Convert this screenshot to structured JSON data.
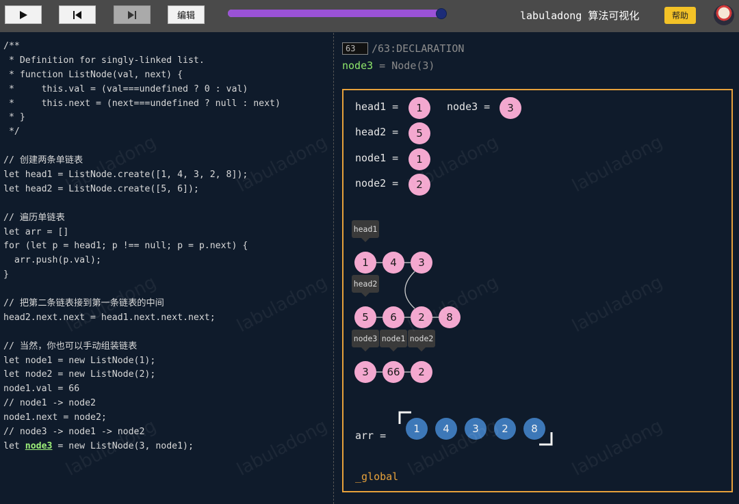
{
  "toolbar": {
    "play_icon": "play-icon",
    "prev_icon": "step-back-icon",
    "next_icon": "step-forward-icon",
    "edit_label": "编辑",
    "progress": 1.0,
    "brand": "labuladong 算法可视化",
    "help_label": "帮助"
  },
  "code": {
    "lines": [
      "/**",
      " * Definition for singly-linked list.",
      " * function ListNode(val, next) {",
      " *     this.val = (val===undefined ? 0 : val)",
      " *     this.next = (next===undefined ? null : next)",
      " * }",
      " */",
      "",
      "// 创建两条单链表",
      "let head1 = ListNode.create([1, 4, 3, 2, 8]);",
      "let head2 = ListNode.create([5, 6]);",
      "",
      "// 遍历单链表",
      "let arr = []",
      "for (let p = head1; p !== null; p = p.next) {",
      "  arr.push(p.val);",
      "}",
      "",
      "// 把第二条链表接到第一条链表的中间",
      "head2.next.next = head1.next.next.next;",
      "",
      "// 当然，你也可以手动组装链表",
      "let node1 = new ListNode(1);",
      "let node2 = new ListNode(2);",
      "node1.val = 66",
      "// node1 -> node2",
      "node1.next = node2;",
      "// node3 -> node1 -> node2"
    ],
    "last_prefix": "let ",
    "last_highlight": "node3",
    "last_suffix": " = new ListNode(3, node1);"
  },
  "step": {
    "input": "63",
    "total": "/63:DECLARATION",
    "decl_var": "node3",
    "decl_rest": " = Node(3)"
  },
  "viz": {
    "vars": [
      {
        "label": "head1 =",
        "value": "1"
      },
      {
        "label": "node3 =",
        "value": "3"
      },
      {
        "label": "head2 =",
        "value": "5"
      },
      {
        "label": "node1 =",
        "value": "1"
      },
      {
        "label": "node2 =",
        "value": "2"
      }
    ],
    "tags": [
      "head1",
      "head2",
      "node3",
      "node1",
      "node2"
    ],
    "list1": [
      "1",
      "4",
      "3",
      "2",
      "8"
    ],
    "list2": [
      "5",
      "6"
    ],
    "list3": [
      "3",
      "66",
      "2"
    ],
    "arr_label": "arr =",
    "arr": [
      "1",
      "4",
      "3",
      "2",
      "8"
    ],
    "global": "_global"
  },
  "watermark": "labuladong"
}
